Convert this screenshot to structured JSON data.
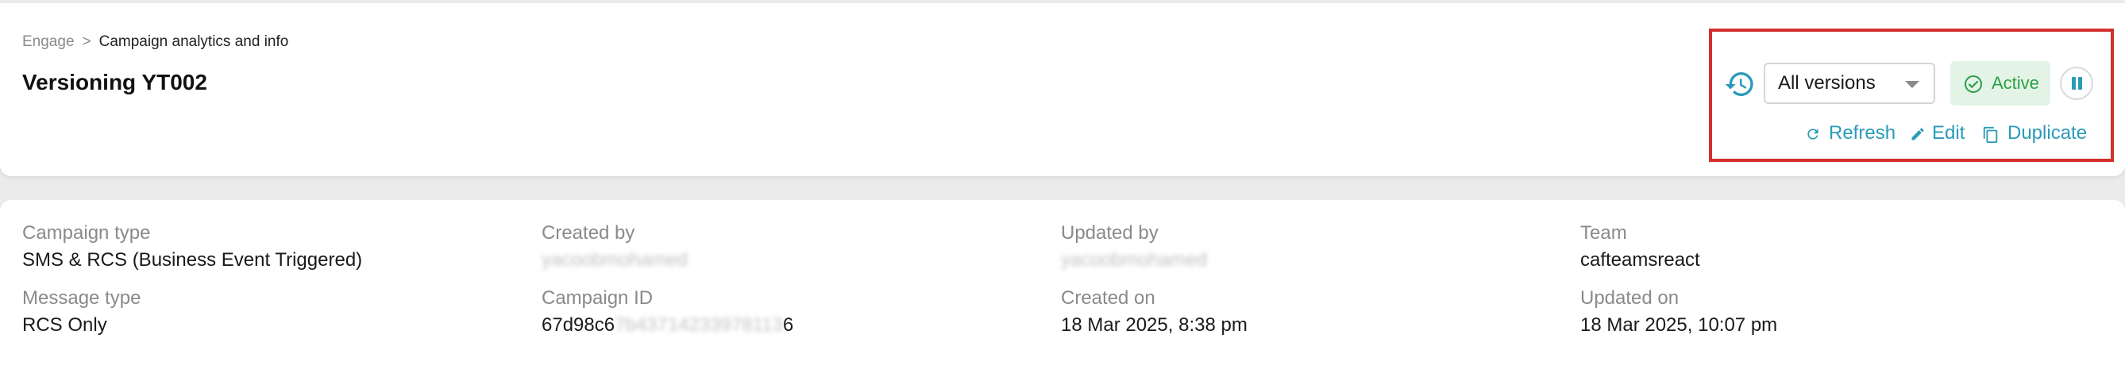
{
  "header": {
    "breadcrumb": {
      "root": "Engage",
      "separator": ">",
      "current": "Campaign analytics and info"
    },
    "title": "Versioning YT002",
    "version_select": {
      "value": "All versions"
    },
    "status": {
      "label": "Active",
      "color": "#2e9e48"
    },
    "actions": {
      "refresh": "Refresh",
      "edit": "Edit",
      "duplicate": "Duplicate"
    },
    "accent_color": "#2a9bb8",
    "highlight_color": "#d32f2f"
  },
  "details": {
    "campaign_type": {
      "label": "Campaign type",
      "value": "SMS & RCS (Business Event Triggered)"
    },
    "created_by": {
      "label": "Created by",
      "value": "yacoobmohamed"
    },
    "updated_by": {
      "label": "Updated by",
      "value": "yacoobmohamed"
    },
    "team": {
      "label": "Team",
      "value": "cafteamsreact"
    },
    "message_type": {
      "label": "Message type",
      "value": "RCS Only"
    },
    "campaign_id": {
      "label": "Campaign ID",
      "value_visible": "67d98c6",
      "value_blurred": "7b43714233978113",
      "value_tail": "6"
    },
    "created_on": {
      "label": "Created on",
      "value": "18 Mar 2025, 8:38 pm"
    },
    "updated_on": {
      "label": "Updated on",
      "value": "18 Mar 2025, 10:07 pm"
    }
  }
}
